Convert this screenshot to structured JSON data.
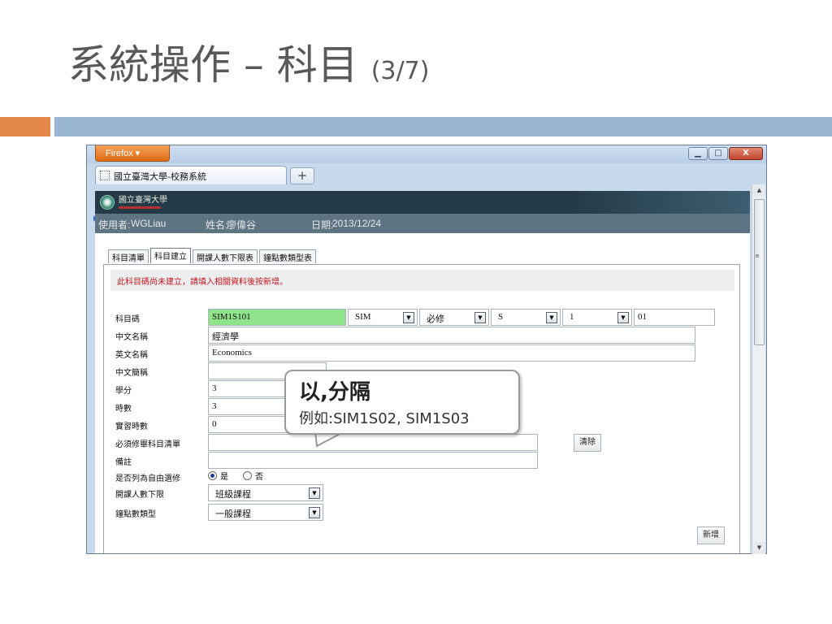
{
  "slide": {
    "title_main": "系統操作 – 科目",
    "title_sub": "(3/7)"
  },
  "browser": {
    "menu_button": "Firefox ▾",
    "tab_title": "國立臺灣大學-校務系統",
    "new_tab": "+",
    "controls": {
      "minimize": "▁",
      "maximize": "□",
      "close": "X"
    }
  },
  "site": {
    "logo_text": "國立臺灣大學",
    "user_label": "使用者:",
    "user_value": "WGLiau",
    "name_label": "姓名:",
    "name_value": "廖偉谷",
    "date_label": "日期:",
    "date_value": "2013/12/24"
  },
  "page_tabs": [
    "科目清單",
    "科目建立",
    "開課人數下限表",
    "鐘點數類型表"
  ],
  "notice": "此科目碼尚未建立，請填入相關資料後按新增。",
  "form": {
    "labels": {
      "course_code": "科目碼",
      "chinese_name": "中文名稱",
      "english_name": "英文名稱",
      "chinese_short": "中文簡稱",
      "credits": "學分",
      "hours": "時數",
      "lab_hours": "實習時數",
      "prereq": "必須修畢科目清單",
      "remarks": "備註",
      "free_elective": "是否列為自由選修",
      "min_enroll": "開課人數下限",
      "hour_type": "鐘點數類型"
    },
    "values": {
      "course_code": "SIM1S101",
      "dept_select": "SIM",
      "required_select": "必修",
      "level_select": "S",
      "number_select": "1",
      "section": "01",
      "chinese_name": "經濟學",
      "english_name": "Economics",
      "chinese_short": "",
      "credits": "3",
      "hours": "3",
      "lab_hours": "0",
      "prereq": "",
      "remarks": "",
      "min_enroll_select": "班級課程",
      "hour_type_select": "一般課程"
    },
    "radio_yes": "是",
    "radio_no": "否",
    "clear_button": "清除",
    "add_button": "新增"
  },
  "callout": {
    "line1": "以,分隔",
    "line2": "例如:SIM1S02, SIM1S03"
  },
  "colors": {
    "accent_orange": "#e3874b",
    "accent_blue": "#98b6d2",
    "notice_red": "#c4161c",
    "course_code_green": "#8fe38a"
  }
}
